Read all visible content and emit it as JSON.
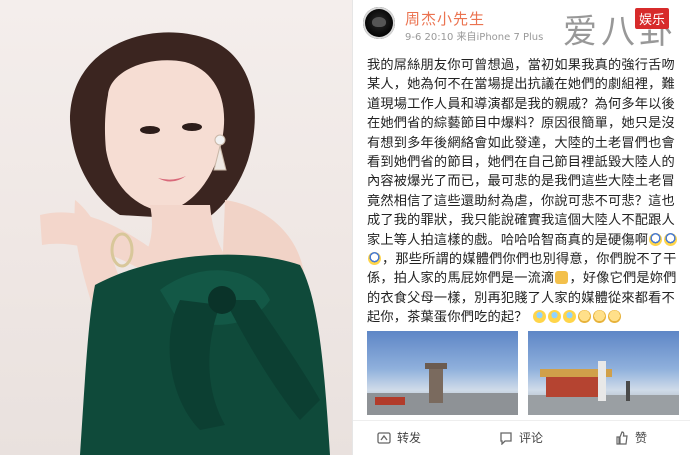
{
  "weibo": {
    "username": "周杰小先生",
    "meta": "9-6 20:10 来自iPhone 7 Plus",
    "watermark": "爱八卦",
    "badge": "娱乐",
    "body_part1": "我的屌絲朋友你可曾想過，當初如果我真的強行舌吻某人，她為何不在當場提出抗議在她們的劇組裡，難道現場工作人員和導演都是我的親戚？為何多年以後在她們省的綜藝節目中爆料？原因很簡單，她只是沒有想到多年後網絡會如此發達，大陸的土老冒們也會看到她們省的節目，她們在自己節目裡詆毀大陸人的內容被爆光了而已，最可悲的是我們這些大陸土老冒竟然相信了這些還助紂為虐，你說可悲不可悲？這也成了我的罪狀，我只能說確實我這個大陸人不配跟人家上等人拍這樣的戲。哈哈哈智商真的是硬傷啊",
    "body_part2": "，那些所謂的媒體們你們也別得意，你們脫不了干係，拍人家的馬屁妳們是一流滴",
    "body_part3": "，好像它們是妳們的衣食父母一樣，別再犯賤了人家的媒體從來都看不起你，茶葉蛋你們吃的起？",
    "actions": {
      "repost": "转发",
      "comment": "评论",
      "like": "赞"
    }
  },
  "colors": {
    "username": "#eb7350",
    "badge": "#d72b2b",
    "photo_dress": "#0f4a3a"
  }
}
